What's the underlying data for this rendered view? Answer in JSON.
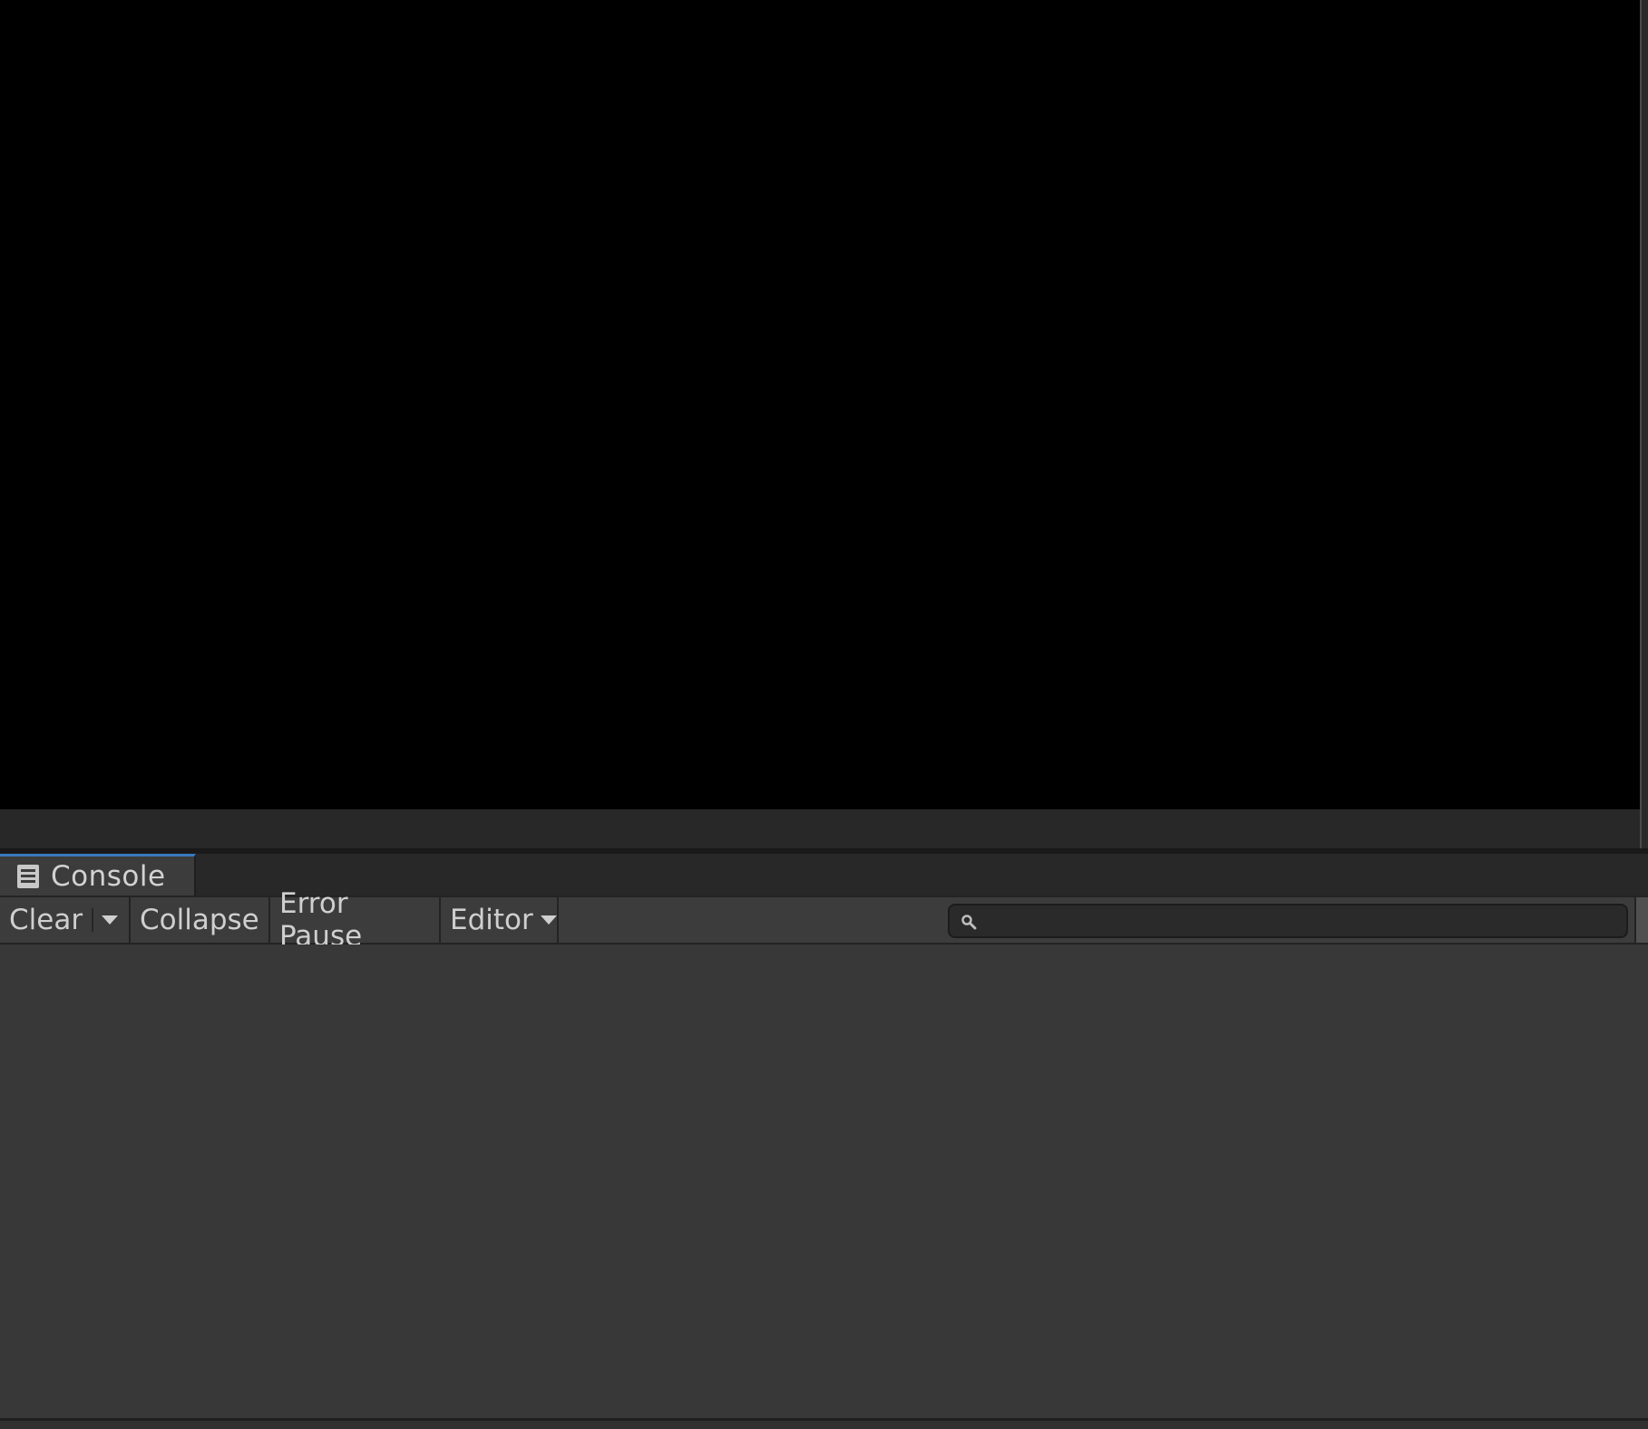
{
  "console_tab": {
    "label": "Console",
    "icon": "console-list-icon",
    "accent_color": "#3a79bb"
  },
  "toolbar": {
    "clear_label": "Clear",
    "collapse_label": "Collapse",
    "error_pause_label": "Error Pause",
    "editor_label": "Editor"
  },
  "search": {
    "value": "",
    "icon": "search-icon"
  }
}
